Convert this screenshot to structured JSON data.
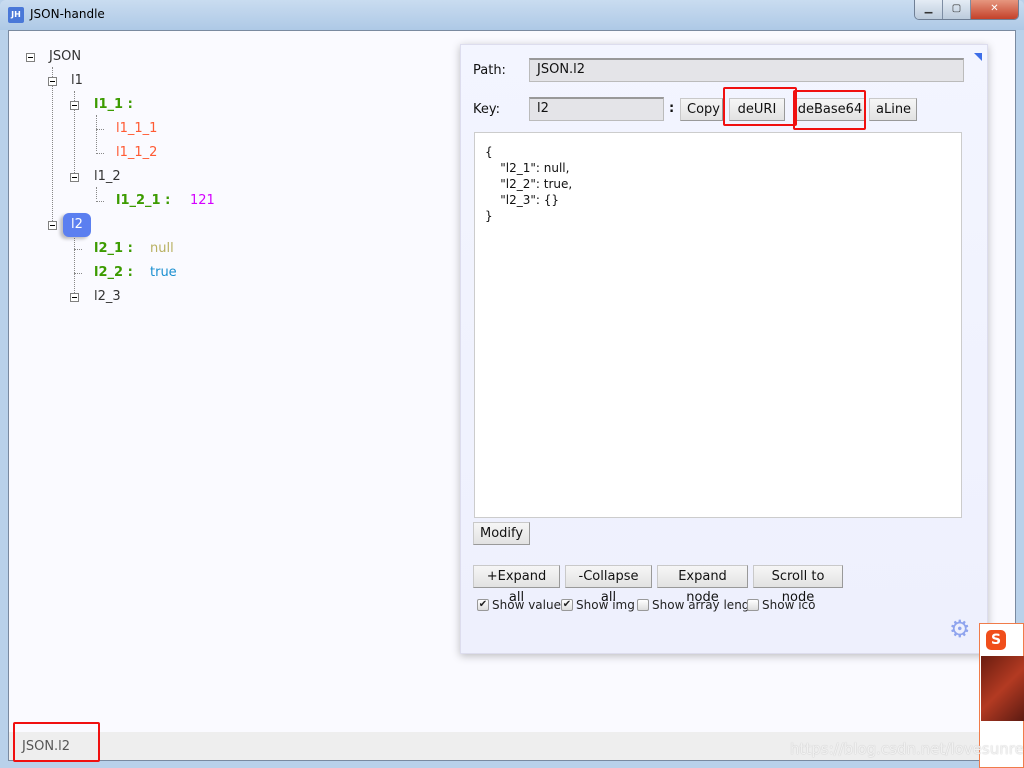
{
  "window": {
    "title": "JSON-handle",
    "icon_text": "JH",
    "minimize": "minimize-icon",
    "maximize": "maximize-icon",
    "close": "close-icon"
  },
  "tree": {
    "root": "JSON",
    "l1": "l1",
    "l1_1": "l1_1 :",
    "l1_1_1": "l1_1_1",
    "l1_1_2": "l1_1_2",
    "l1_2": "l1_2",
    "l1_2_1": "l1_2_1 :",
    "l1_2_1_value": "121",
    "l2": "l2",
    "l2_1": "l2_1 :",
    "l2_1_value": "null",
    "l2_2": "l2_2 :",
    "l2_2_value": "true",
    "l2_3": "l2_3"
  },
  "panel": {
    "path_label": "Path:",
    "path_value": "JSON.l2",
    "key_label": "Key:",
    "key_value": "l2",
    "colon": ":",
    "buttons": {
      "copy": "Copy",
      "deuri": "deURI",
      "debase64": "deBase64",
      "aline": "aLine",
      "modify": "Modify",
      "expand_all": "+Expand all",
      "collapse_all": "-Collapse all",
      "expand_node": "Expand node",
      "scroll_to_node": "Scroll to node"
    },
    "json_text": "{\n    \"l2_1\": null,\n    \"l2_2\": true,\n    \"l2_3\": {}\n}",
    "checkboxes": [
      {
        "label": "Show value",
        "checked": true
      },
      {
        "label": "Show img",
        "checked": true
      },
      {
        "label": "Show array leng",
        "checked": false
      },
      {
        "label": "Show ico",
        "checked": false
      }
    ],
    "settings_icon": "gear-icon"
  },
  "status_bar": {
    "path": "JSON.l2"
  },
  "watermark": "https://blog.csdn.net/lovesunren",
  "colors": {
    "selected_node": "#5b7ff0",
    "key_bold": "#3c9b00",
    "key_leaf": "#ff5a33",
    "number": "#d400ff",
    "null": "#b8b060",
    "true": "#1a8fd0",
    "highlight": "#f01010"
  }
}
